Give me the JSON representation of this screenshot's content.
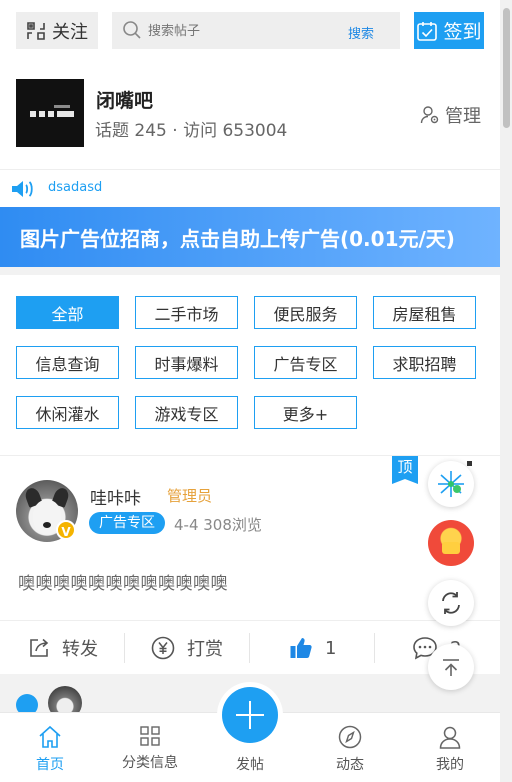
{
  "header": {
    "follow_label": "关注",
    "search_placeholder": "搜索帖子",
    "search_button": "搜索",
    "signin_label": "签到"
  },
  "forum": {
    "name": "闭嘴吧",
    "stats": "话题 245 · 访问 653004",
    "manage_label": "管理"
  },
  "notice": {
    "text": "dsadasd"
  },
  "ad_banner": {
    "text": "图片广告位招商，点击自助上传广告(0.01元/天)"
  },
  "categories": [
    {
      "label": "全部",
      "active": true
    },
    {
      "label": "二手市场"
    },
    {
      "label": "便民服务"
    },
    {
      "label": "房屋租售"
    },
    {
      "label": "信息查询"
    },
    {
      "label": "时事爆料"
    },
    {
      "label": "广告专区"
    },
    {
      "label": "求职招聘"
    },
    {
      "label": "休闲灌水"
    },
    {
      "label": "游戏专区"
    },
    {
      "label": "更多+"
    }
  ],
  "post": {
    "pin_label": "顶",
    "author": "哇咔咔",
    "role": "管理员",
    "badge": "V",
    "category": "广告专区",
    "meta": "4-4  308浏览",
    "body": "噢噢噢噢噢噢噢噢噢噢噢噢",
    "actions": {
      "share": "转发",
      "reward": "打赏",
      "like_count": "1",
      "comment_count": "2"
    }
  },
  "tabbar": {
    "home": "首页",
    "categories": "分类信息",
    "post": "发帖",
    "activity": "动态",
    "mine": "我的"
  },
  "colors": {
    "accent": "#1e9ff2",
    "role": "#e6a23c",
    "badge": "#f5b400"
  }
}
